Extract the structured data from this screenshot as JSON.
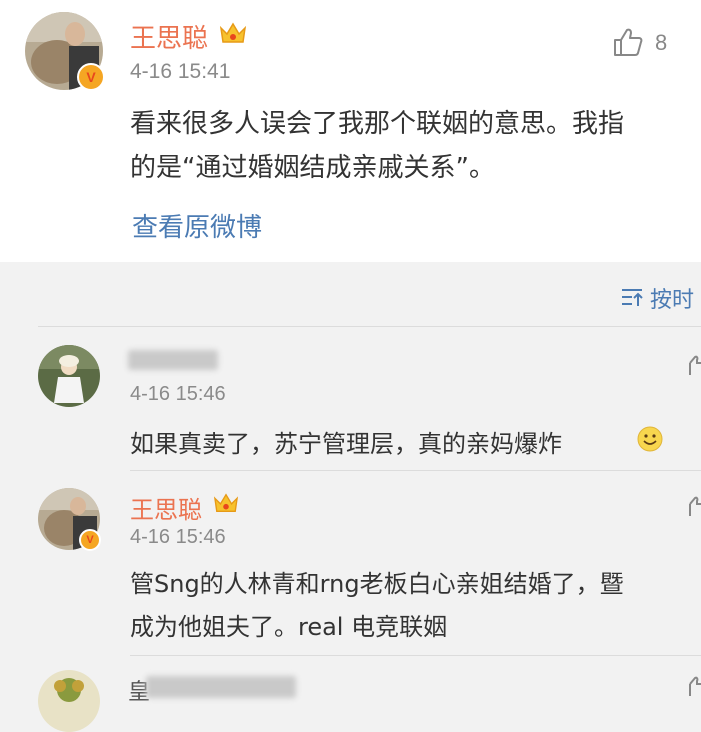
{
  "main_post": {
    "author": "王思聪",
    "time": "4-16 15:41",
    "like_count": "8",
    "text_line1": "看来很多人误会了我那个联姻的意思。我指",
    "text_line2": "的是“通过婚姻结成亲戚关系”。",
    "view_original": "查看原微博"
  },
  "sort": {
    "label": "按时"
  },
  "comments": [
    {
      "author": "",
      "time": "4-16 15:46",
      "text": "如果真卖了，苏宁管理层，真的亲妈爆炸"
    },
    {
      "author": "王思聪",
      "time": "4-16 15:46",
      "text_line1": "管Sng的人林青和rng老板白心亲姐结婚了，暨",
      "text_line2": "成为他姐夫了。real 电竞联姻"
    },
    {
      "author": "皇"
    }
  ],
  "colors": {
    "name": "#eb7350",
    "link": "#4b7bb3",
    "time": "#8a8a8a",
    "text": "#333333",
    "background": "#f2f2f2"
  }
}
